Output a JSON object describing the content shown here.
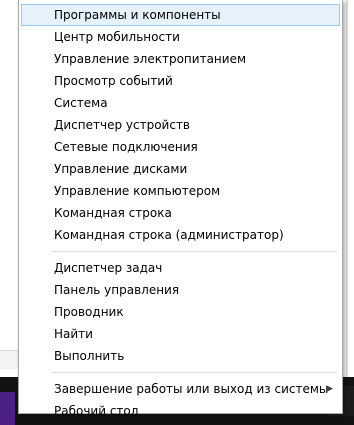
{
  "menu": {
    "groups": [
      [
        {
          "label": "Программы и компоненты",
          "highlighted": true
        },
        {
          "label": "Центр мобильности"
        },
        {
          "label": "Управление электропитанием"
        },
        {
          "label": "Просмотр событий"
        },
        {
          "label": "Система"
        },
        {
          "label": "Диспетчер устройств"
        },
        {
          "label": "Сетевые подключения"
        },
        {
          "label": "Управление дисками"
        },
        {
          "label": "Управление компьютером"
        },
        {
          "label": "Командная строка"
        },
        {
          "label": "Командная строка (администратор)"
        }
      ],
      [
        {
          "label": "Диспетчер задач"
        },
        {
          "label": "Панель управления"
        },
        {
          "label": "Проводник"
        },
        {
          "label": "Найти"
        },
        {
          "label": "Выполнить"
        }
      ],
      [
        {
          "label": "Завершение работы или выход из системы",
          "submenu": true
        },
        {
          "label": "Рабочий стол"
        }
      ]
    ],
    "submenu_arrow": "▶"
  },
  "colors": {
    "highlight_bg": "#e5f1fb",
    "highlight_border": "#99c9ef",
    "taskbar": "#121212",
    "start_button": "#4b1f83"
  }
}
